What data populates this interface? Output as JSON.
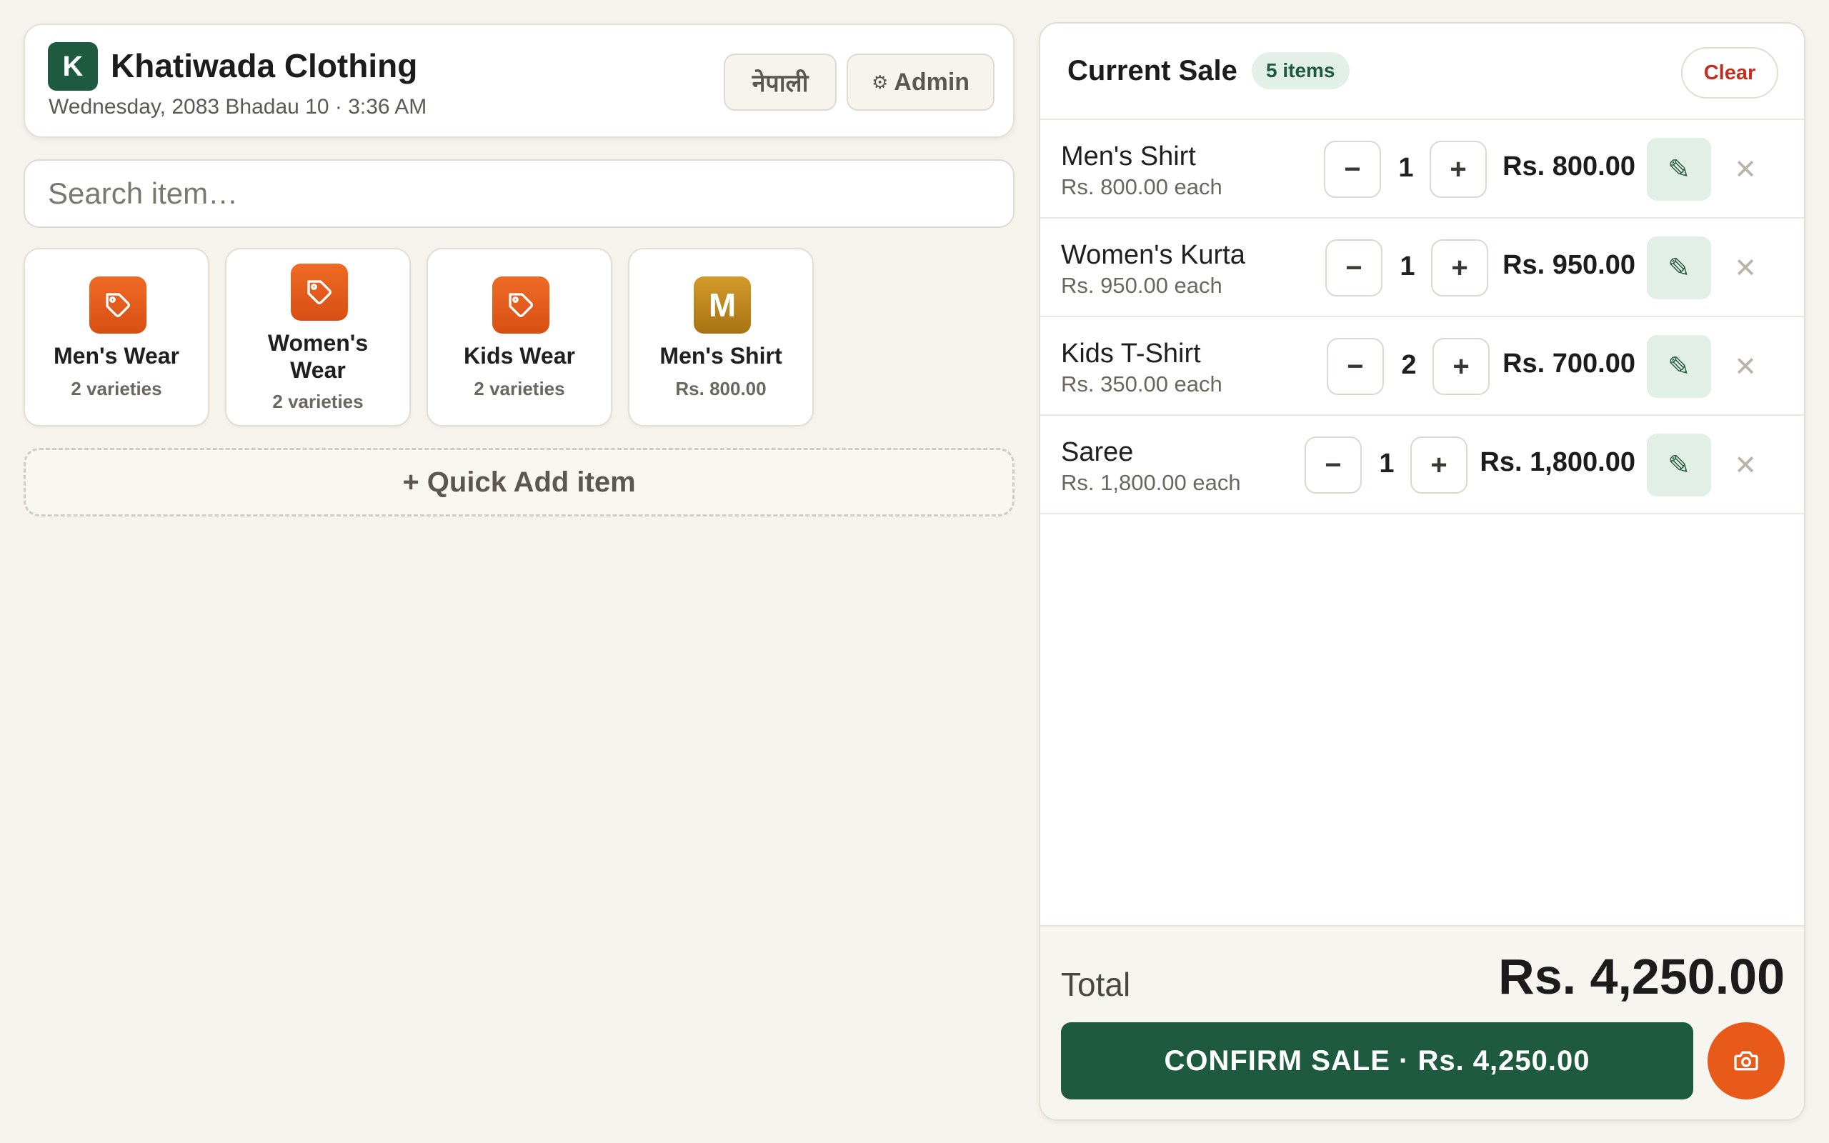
{
  "header": {
    "logo_letter": "K",
    "store_name": "Khatiwada Clothing",
    "date_time": "Wednesday, 2083 Bhadau 10 · 3:36 AM",
    "language_button": "नेपाली",
    "admin_button": "Admin",
    "admin_icon": "gear-icon"
  },
  "search": {
    "placeholder": "Search item…",
    "value": ""
  },
  "tiles": [
    {
      "icon": "tag-icon",
      "name": "Men's Wear",
      "sub": "2 varieties"
    },
    {
      "icon": "tag-icon",
      "name": "Women's Wear",
      "sub": "2 varieties"
    },
    {
      "icon": "tag-icon",
      "name": "Kids Wear",
      "sub": "2 varieties"
    },
    {
      "icon_letter": "M",
      "name": "Men's Shirt",
      "sub": "Rs. 800.00"
    }
  ],
  "quick_add_label": "+ Quick Add item",
  "sale": {
    "title": "Current Sale",
    "items_badge": "5 items",
    "clear_label": "Clear",
    "rows": [
      {
        "name": "Men's Shirt",
        "each": "Rs. 800.00 each",
        "qty": "1",
        "total": "Rs. 800.00"
      },
      {
        "name": "Women's Kurta",
        "each": "Rs. 950.00 each",
        "qty": "1",
        "total": "Rs. 950.00"
      },
      {
        "name": "Kids T-Shirt",
        "each": "Rs. 350.00 each",
        "qty": "2",
        "total": "Rs. 700.00"
      },
      {
        "name": "Saree",
        "each": "Rs. 1,800.00 each",
        "qty": "1",
        "total": "Rs. 1,800.00"
      }
    ],
    "minus_glyph": "−",
    "plus_glyph": "+",
    "edit_glyph": "✎",
    "remove_glyph": "✕",
    "total_label": "Total",
    "total_value": "Rs. 4,250.00",
    "confirm_label": "CONFIRM SALE · Rs. 4,250.00",
    "camera_icon": "camera-icon"
  },
  "colors": {
    "brand_green": "#1d5a3f",
    "accent_orange": "#e85a1a",
    "clear_red": "#c2311f",
    "background": "#f6f3ec"
  }
}
